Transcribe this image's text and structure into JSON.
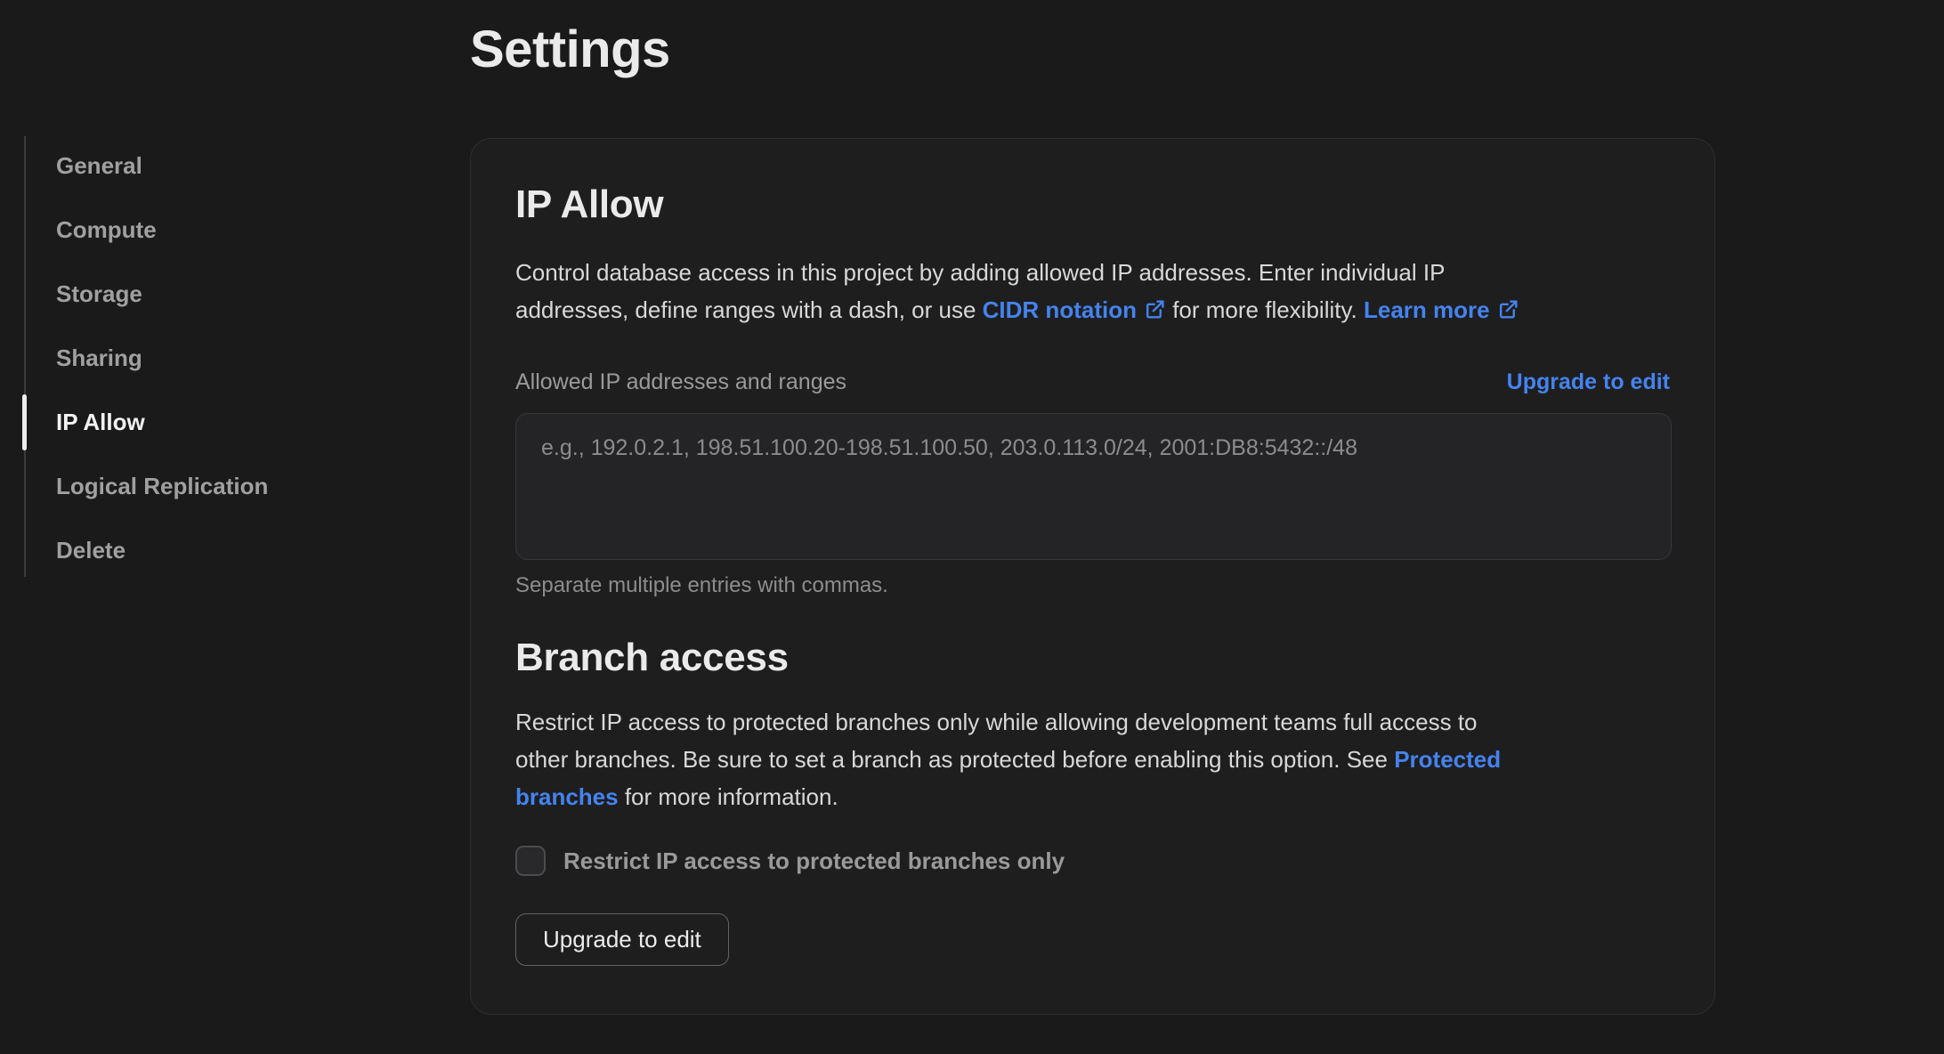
{
  "page": {
    "title": "Settings"
  },
  "colors": {
    "accent_blue": "#4583ee"
  },
  "sidebar": {
    "items": [
      {
        "label": "General",
        "active": false
      },
      {
        "label": "Compute",
        "active": false
      },
      {
        "label": "Storage",
        "active": false
      },
      {
        "label": "Sharing",
        "active": false
      },
      {
        "label": "IP Allow",
        "active": true
      },
      {
        "label": "Logical Replication",
        "active": false
      },
      {
        "label": "Delete",
        "active": false
      }
    ]
  },
  "ip_allow": {
    "heading": "IP Allow",
    "description_lines": [
      [
        {
          "text": "Control database access in this project by adding allowed IP addresses. Enter individual IP"
        }
      ],
      [
        {
          "text": "addresses, define ranges with a dash, or use "
        },
        {
          "link": "CIDR notation",
          "ext": true
        },
        {
          "text": " for more flexibility. "
        },
        {
          "link": "Learn more",
          "ext": true
        }
      ]
    ],
    "field_label": "Allowed IP addresses and ranges",
    "upgrade_link": "Upgrade to edit",
    "textarea_value": "",
    "textarea_placeholder": "e.g., 192.0.2.1, 198.51.100.20-198.51.100.50, 203.0.113.0/24, 2001:DB8:5432::/48",
    "helper": "Separate multiple entries with commas."
  },
  "branch_access": {
    "heading": "Branch access",
    "description_lines": [
      [
        {
          "text": "Restrict IP access to protected branches only while allowing development teams full access to"
        }
      ],
      [
        {
          "text": "other branches. Be sure to set a branch as protected before enabling this option. See "
        },
        {
          "link": "Protected"
        }
      ],
      [
        {
          "link": "branches"
        },
        {
          "text": " for more information."
        }
      ]
    ],
    "checkbox_label": "Restrict IP access to protected branches only",
    "checkbox_checked": false,
    "button_label": "Upgrade to edit"
  }
}
